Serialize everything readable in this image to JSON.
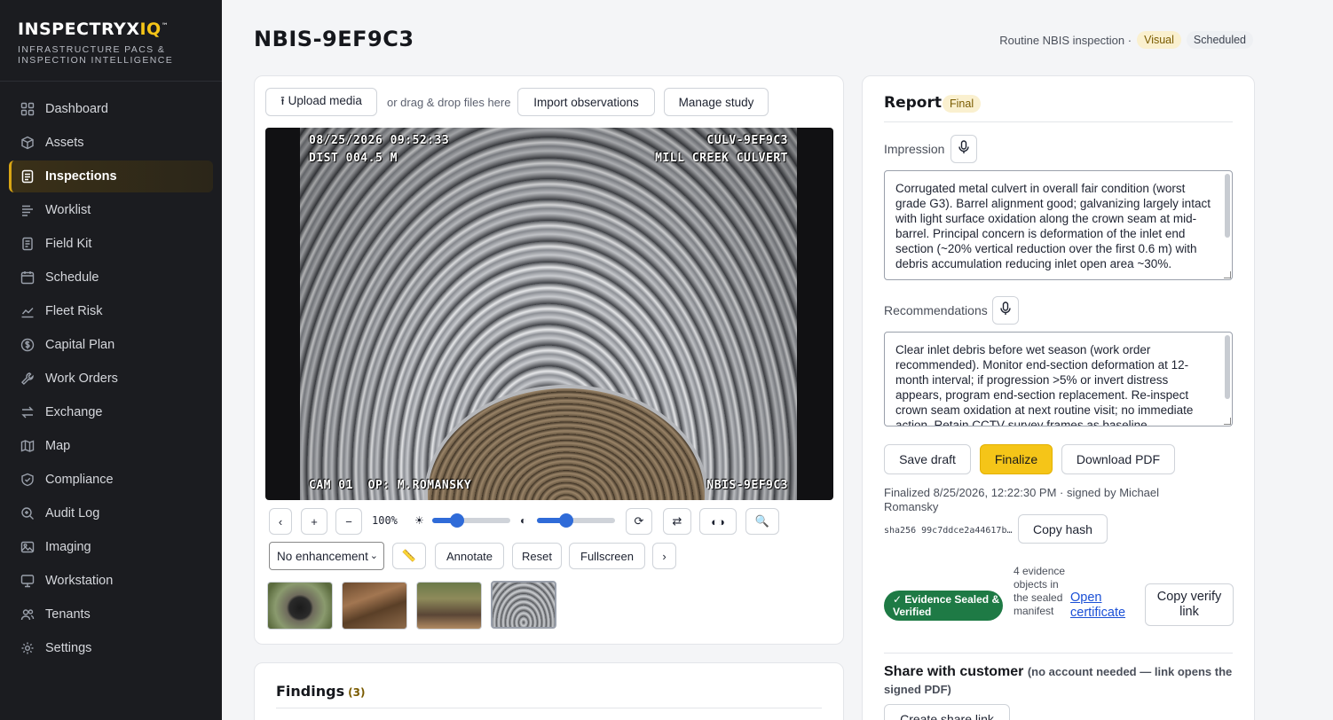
{
  "brand": {
    "logo_main": "INSPECTRYX",
    "logo_accent": "IQ",
    "logo_tm": "™",
    "tagline": "Infrastructure PACS & Inspection Intelligence"
  },
  "sidebar": {
    "items": [
      {
        "label": "Dashboard",
        "icon": "grid-icon"
      },
      {
        "label": "Assets",
        "icon": "cube-icon"
      },
      {
        "label": "Inspections",
        "icon": "clipboard-icon",
        "active": true
      },
      {
        "label": "Worklist",
        "icon": "list-icon"
      },
      {
        "label": "Field Kit",
        "icon": "document-icon"
      },
      {
        "label": "Schedule",
        "icon": "calendar-icon"
      },
      {
        "label": "Fleet Risk",
        "icon": "trend-icon"
      },
      {
        "label": "Capital Plan",
        "icon": "dollar-icon"
      },
      {
        "label": "Work Orders",
        "icon": "wrench-icon"
      },
      {
        "label": "Exchange",
        "icon": "swap-icon"
      },
      {
        "label": "Map",
        "icon": "map-icon"
      },
      {
        "label": "Compliance",
        "icon": "shield-icon"
      },
      {
        "label": "Audit Log",
        "icon": "magnifier-icon"
      },
      {
        "label": "Imaging",
        "icon": "image-icon"
      },
      {
        "label": "Workstation",
        "icon": "monitor-icon"
      },
      {
        "label": "Tenants",
        "icon": "users-icon"
      },
      {
        "label": "Settings",
        "icon": "gear-icon"
      }
    ]
  },
  "header": {
    "title": "NBIS-9EF9C3",
    "inspection_type": "Routine NBIS inspection ·",
    "method_badge": "Visual",
    "status_badge": "Scheduled"
  },
  "media": {
    "upload_label": "⭱ Upload media",
    "drop_hint": "or drag & drop files here",
    "import_label": "Import observations",
    "manage_label": "Manage study",
    "osd": {
      "timestamp": "08/25/2026 09:52:33",
      "distance": "DIST 004.5 M",
      "asset_id": "CULV-9EF9C3",
      "location": "MILL CREEK CULVERT",
      "camera_operator": "CAM 01  OP: M.ROMANSKY",
      "inspection_id": "NBIS-9EF9C3"
    },
    "zoom_label": "100%",
    "brightness": 0.32,
    "contrast": 0.38,
    "enhancement_value": "No enhancement",
    "annotate_label": "Annotate",
    "reset_label": "Reset",
    "fullscreen_label": "Fullscreen"
  },
  "findings": {
    "title": "Findings",
    "count": "(3)"
  },
  "report": {
    "title": "Report",
    "status_badge": "Final",
    "impression_label": "Impression",
    "impression_text": "Corrugated metal culvert in overall fair condition (worst grade G3). Barrel alignment good; galvanizing largely intact with light surface oxidation along the crown seam at mid-barrel. Principal concern is deformation of the inlet end section (~20% vertical reduction over the first 0.6 m) with debris accumulation reducing inlet open area ~30%.",
    "recommendations_label": "Recommendations",
    "recommendations_text": "Clear inlet debris before wet season (work order recommended). Monitor end-section deformation at 12-month interval; if progression >5% or invert distress appears, program end-section replacement. Re-inspect crown seam oxidation at next routine visit; no immediate action. Retain CCTV survey frames as baseline.",
    "save_draft_label": "Save draft",
    "finalize_label": "Finalize",
    "download_pdf_label": "Download PDF",
    "finalized_meta": "Finalized 8/25/2026, 12:22:30 PM · signed by Michael Romansky",
    "hash": "sha256 99c7ddce2a44617b…",
    "copy_hash_label": "Copy hash",
    "sealed_label": "✓ Evidence Sealed & Verified",
    "sealed_note": "4 evidence objects in the sealed manifest",
    "open_certificate_label": "Open certificate",
    "copy_verify_label": "Copy verify link",
    "share_title": "Share with customer",
    "share_subtitle": "(no account needed — link opens the signed PDF)",
    "create_share_label": "Create share link"
  },
  "colors": {
    "sidebar_bg": "#1b1c20",
    "accent": "#f5c518",
    "sealed_green": "#1e7a45",
    "link_blue": "#1a4fd6"
  }
}
